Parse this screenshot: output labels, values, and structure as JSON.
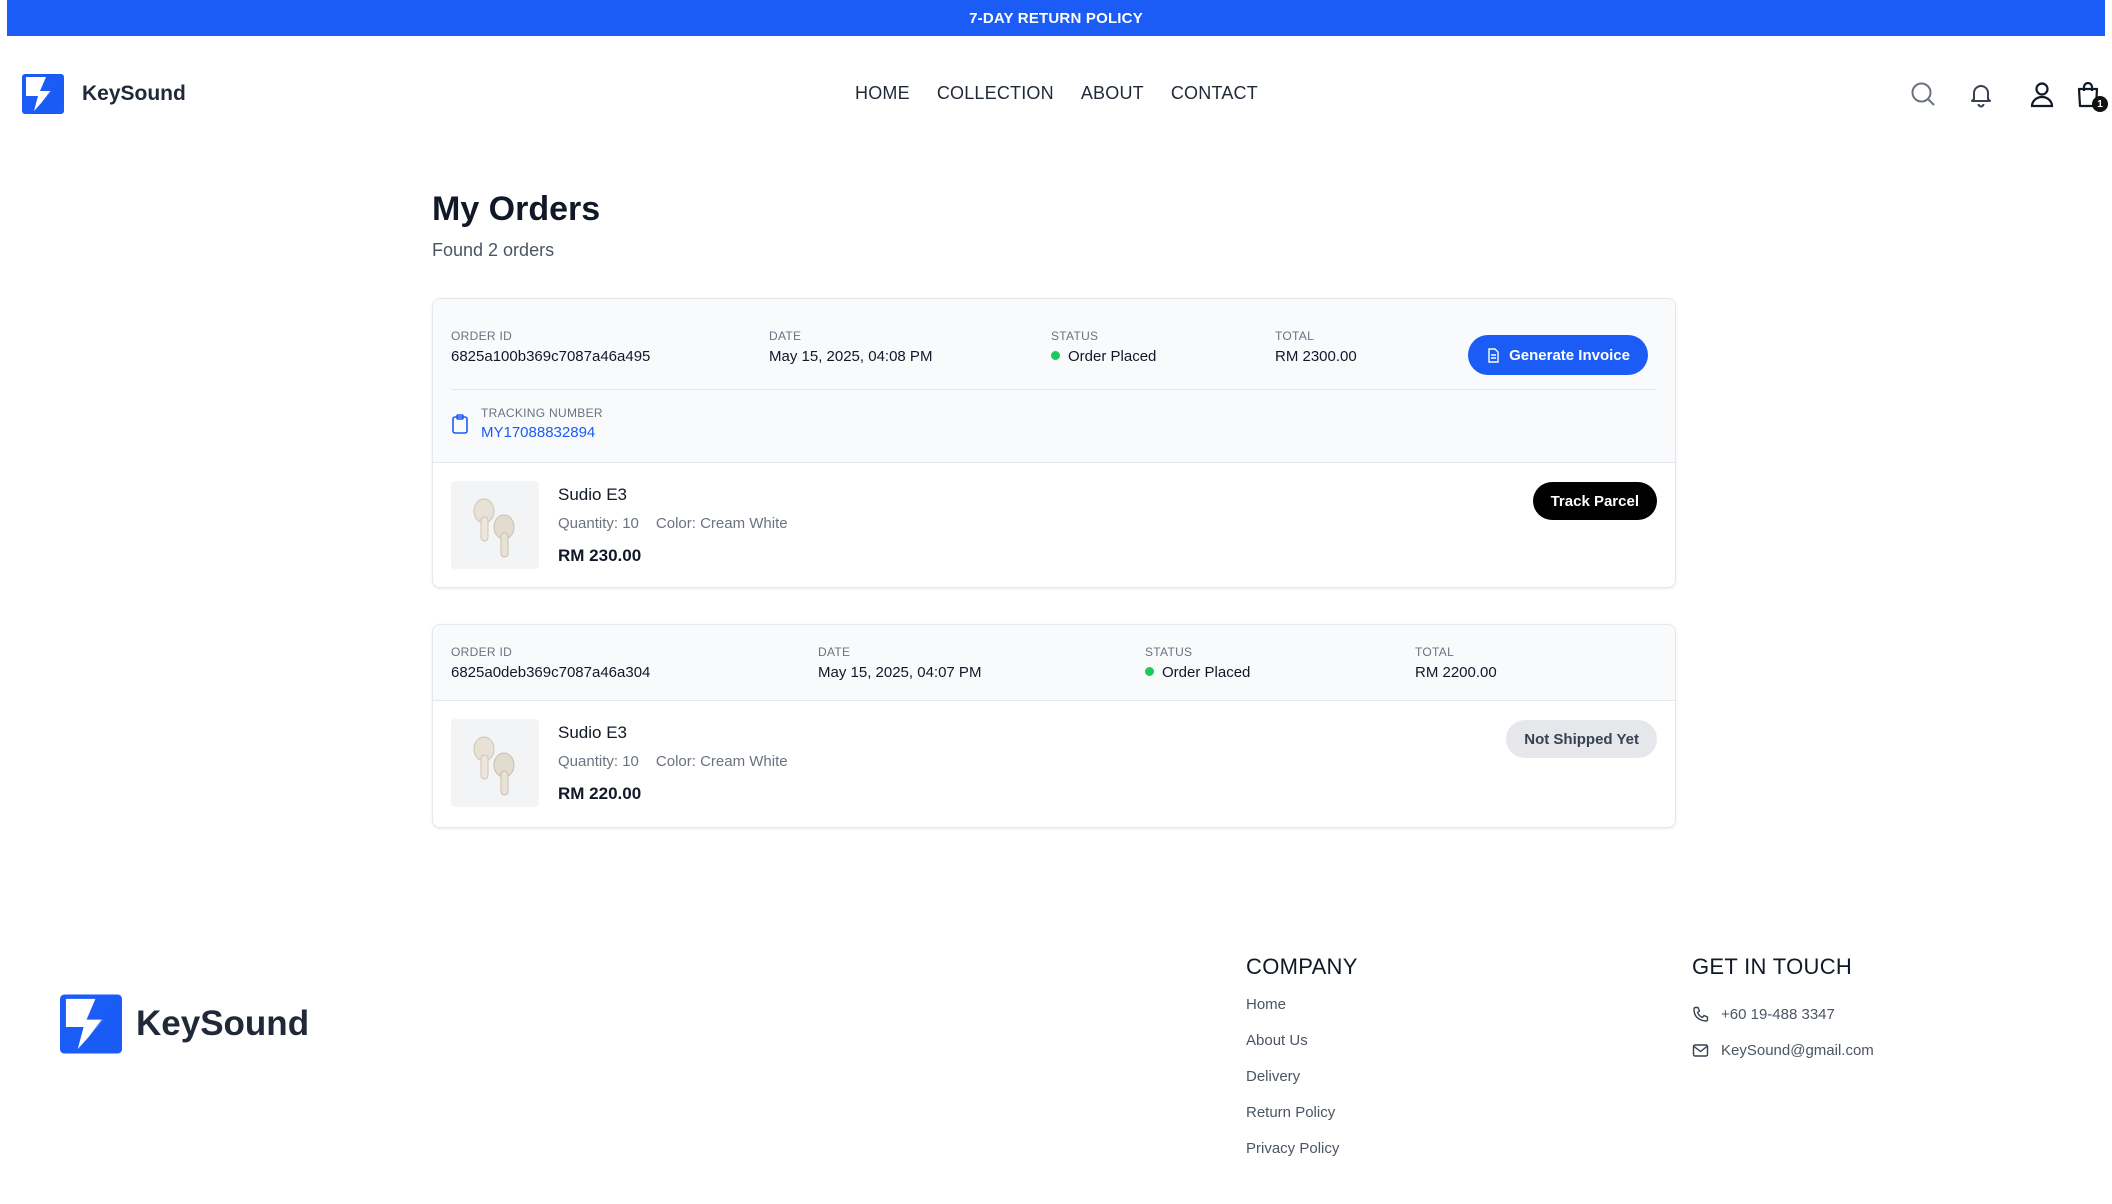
{
  "promo": {
    "text": "7-DAY RETURN POLICY"
  },
  "brand": {
    "name": "KeySound"
  },
  "nav": {
    "items": [
      "HOME",
      "COLLECTION",
      "ABOUT",
      "CONTACT"
    ]
  },
  "header_icons": [
    "search-icon",
    "bell-icon",
    "user-icon",
    "shopping-bag-icon"
  ],
  "cart": {
    "count": "1"
  },
  "colors": {
    "accent": "#1a5cf5",
    "status_dot": "#22c55e",
    "dark_button": "#000000"
  },
  "page": {
    "title": "My Orders",
    "subtitle": "Found 2 orders"
  },
  "labels": {
    "order_id": "ORDER ID",
    "date": "DATE",
    "status": "STATUS",
    "total": "TOTAL",
    "tracking": "TRACKING NUMBER",
    "quantity_prefix": "Quantity: ",
    "color_prefix": "Color: "
  },
  "orders": [
    {
      "id": "6825a100b369c7087a46a495",
      "date": "May 15, 2025, 04:08 PM",
      "status": "Order Placed",
      "total": "RM 2300.00",
      "invoice_label": "Generate Invoice",
      "tracking_number": "MY17088832894",
      "item": {
        "name": "Sudio E3",
        "quantity": "Quantity: 10",
        "color": "Color: Cream White",
        "price": "RM 230.00",
        "action_label": "Track Parcel"
      }
    },
    {
      "id": "6825a0deb369c7087a46a304",
      "date": "May 15, 2025, 04:07 PM",
      "status": "Order Placed",
      "total": "RM 2200.00",
      "item": {
        "name": "Sudio E3",
        "quantity": "Quantity: 10",
        "color": "Color: Cream White",
        "price": "RM 220.00",
        "action_label": "Not Shipped Yet"
      }
    }
  ],
  "footer": {
    "brand": "KeySound",
    "company": {
      "heading": "COMPANY",
      "links": [
        "Home",
        "About Us",
        "Delivery",
        "Return Policy",
        "Privacy Policy"
      ]
    },
    "contact": {
      "heading": "GET IN TOUCH",
      "phone": "+60 19-488 3347",
      "email": "KeySound@gmail.com"
    }
  }
}
